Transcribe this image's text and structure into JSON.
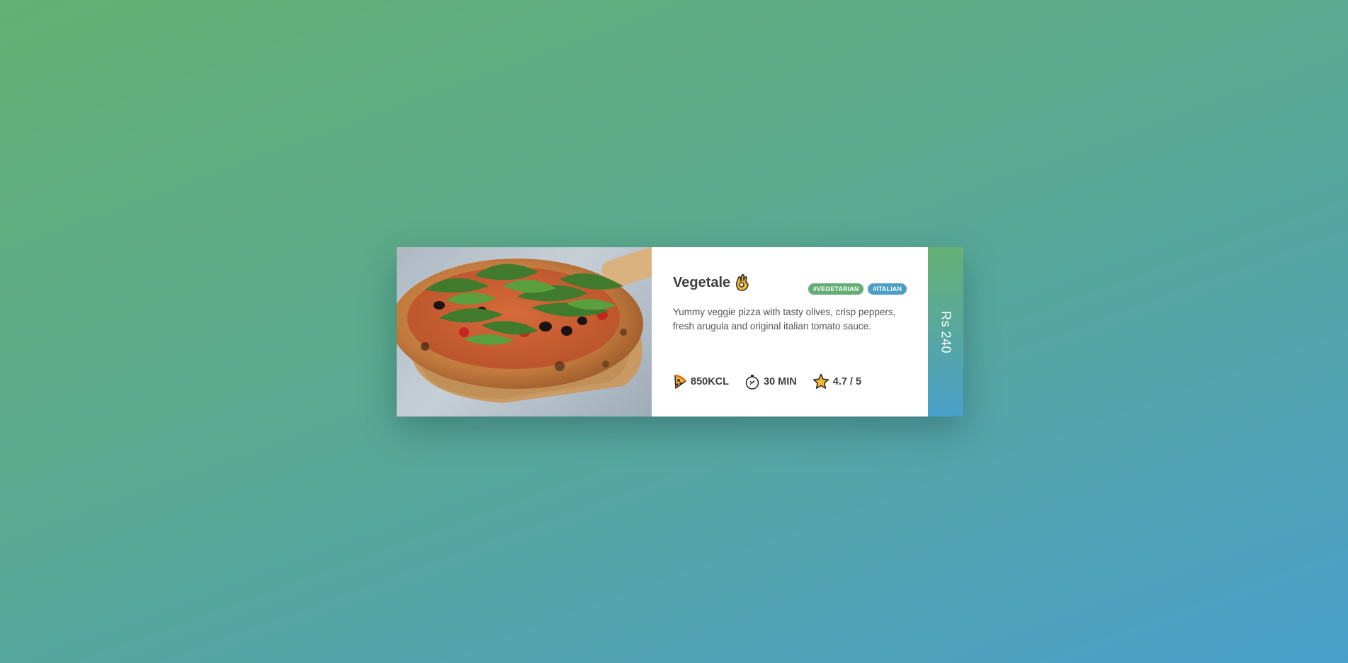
{
  "card": {
    "image_alt": "Vegetable pizza with arugula on a wooden peel",
    "title": "Vegetale",
    "title_icon": "ok-hand-icon",
    "tags": [
      "#VEGETARIAN",
      "#ITALIAN"
    ],
    "description": "Yummy veggie pizza with tasty olives, crisp peppers, fresh arugula and original italian tomato sauce.",
    "stats": {
      "calories": "850KCL",
      "time": "30 MIN",
      "rating": "4.7 / 5"
    },
    "price": "Rs 240"
  },
  "colors": {
    "green": "#63ad74",
    "blue": "#4d9ec6",
    "text": "#3d3d3d",
    "star": "#f5b92e"
  }
}
